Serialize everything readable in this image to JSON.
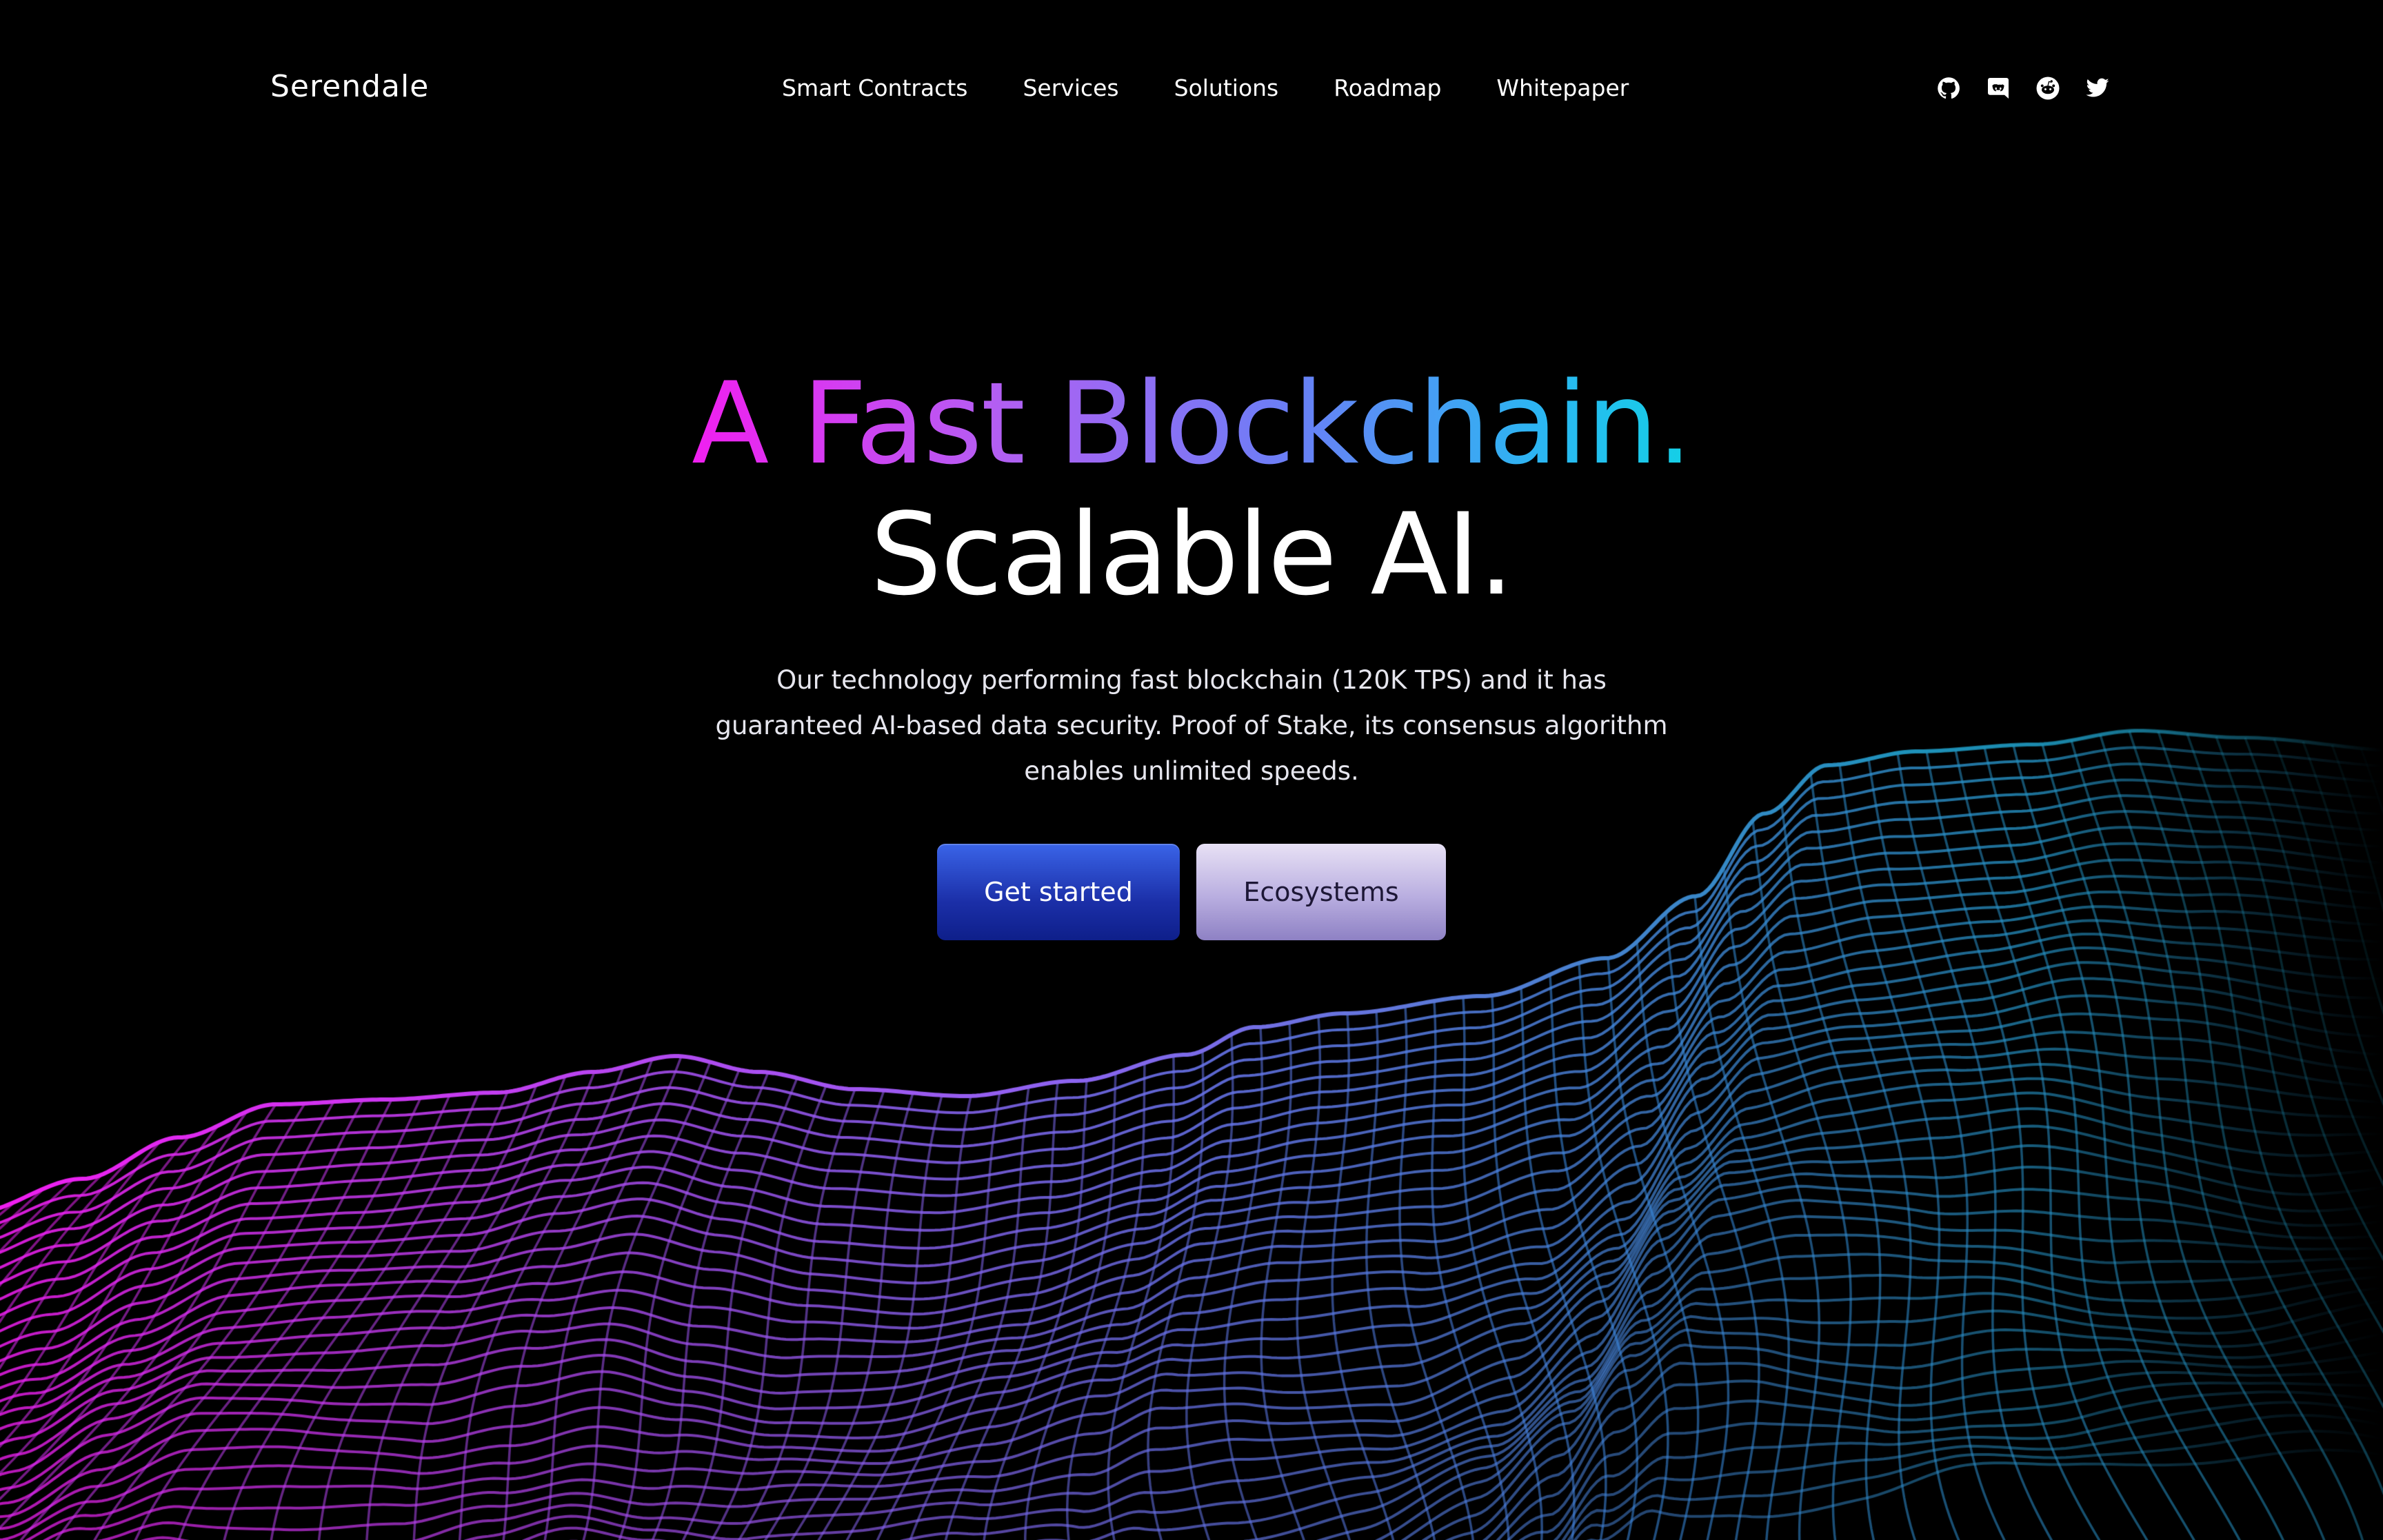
{
  "brand": {
    "name": "Serendale"
  },
  "nav": {
    "links": [
      "Smart Contracts",
      "Services",
      "Solutions",
      "Roadmap",
      "Whitepaper"
    ]
  },
  "socials": [
    {
      "icon": "github-icon"
    },
    {
      "icon": "discord-icon"
    },
    {
      "icon": "reddit-icon"
    },
    {
      "icon": "twitter-icon"
    }
  ],
  "hero": {
    "headline_line1": "A Fast Blockchain.",
    "headline_line2": "Scalable AI.",
    "subtitle": "Our technology performing fast blockchain (120K TPS) and it has guaranteed AI-based data security. Proof of Stake, its consensus algorithm enables unlimited speeds.",
    "primary_cta": "Get started",
    "secondary_cta": "Ecosystems"
  },
  "colors": {
    "background": "#000000",
    "gradient_start": "#f01ff0",
    "gradient_mid": "#8a6cf4",
    "gradient_end": "#14d0e6",
    "primary_button": "#1b2fa8",
    "secondary_button": "#b9aee0"
  }
}
